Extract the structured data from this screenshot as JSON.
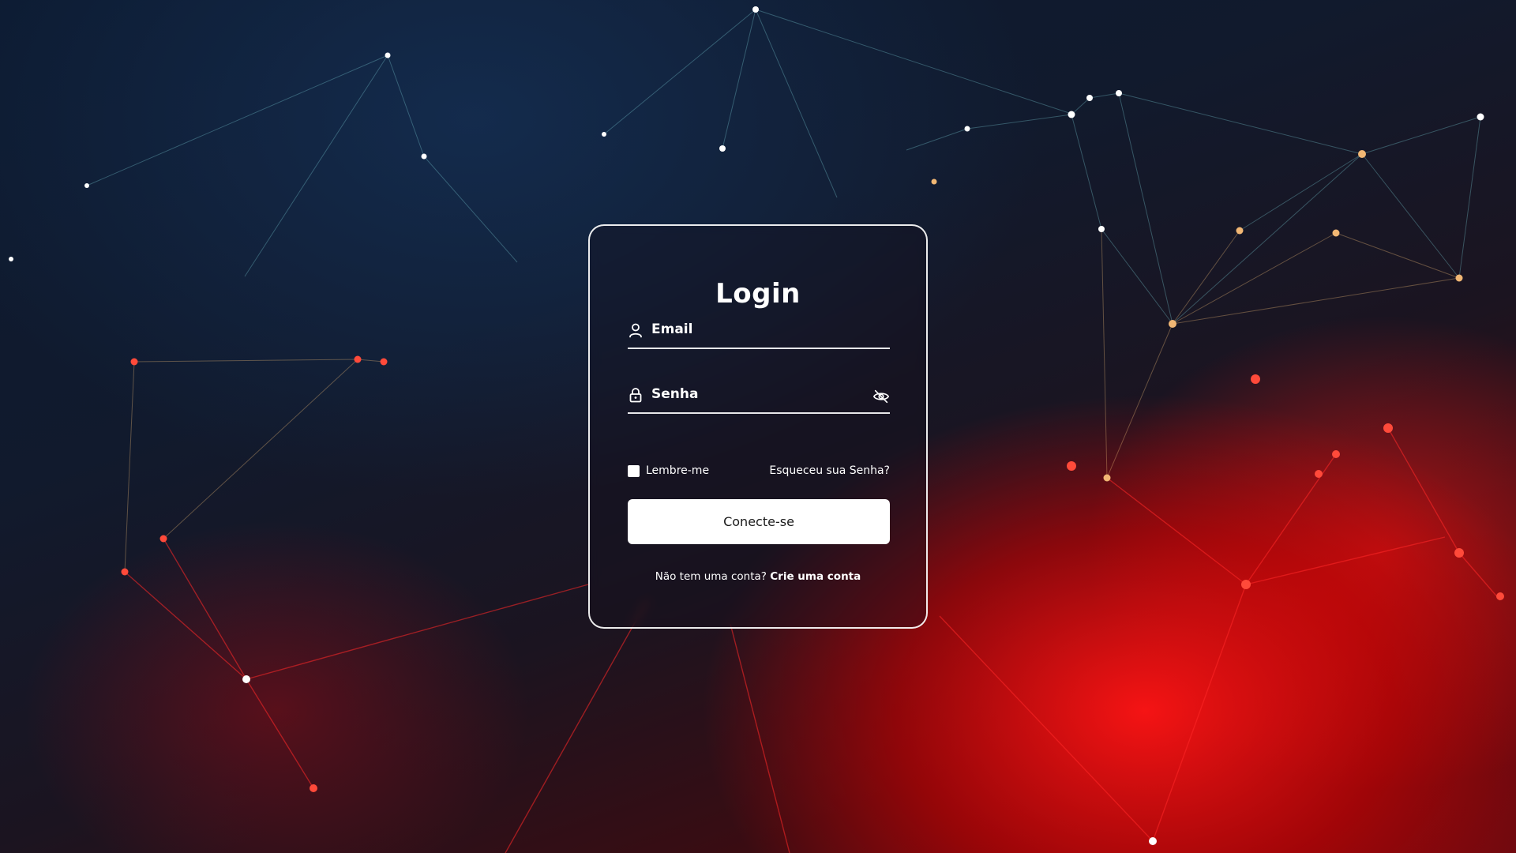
{
  "login_card": {
    "title": "Login",
    "email": {
      "label": "Email",
      "icon": "user-icon"
    },
    "password": {
      "label": "Senha",
      "icon": "lock-icon",
      "toggle_icon": "eye-slash-icon"
    },
    "remember_label": "Lembre-me",
    "remember_checked": false,
    "forgot_link": "Esqueceu sua Senha?",
    "submit_label": "Conecte-se",
    "signup_prompt": "Não tem uma conta?",
    "signup_link": "Crie uma conta"
  },
  "colors": {
    "card_border": "#ffffff",
    "button_bg": "#ffffff",
    "button_text": "#1a1a1a",
    "text": "#ffffff",
    "background_dark": "#0c1a30",
    "background_red": "#e50914"
  }
}
